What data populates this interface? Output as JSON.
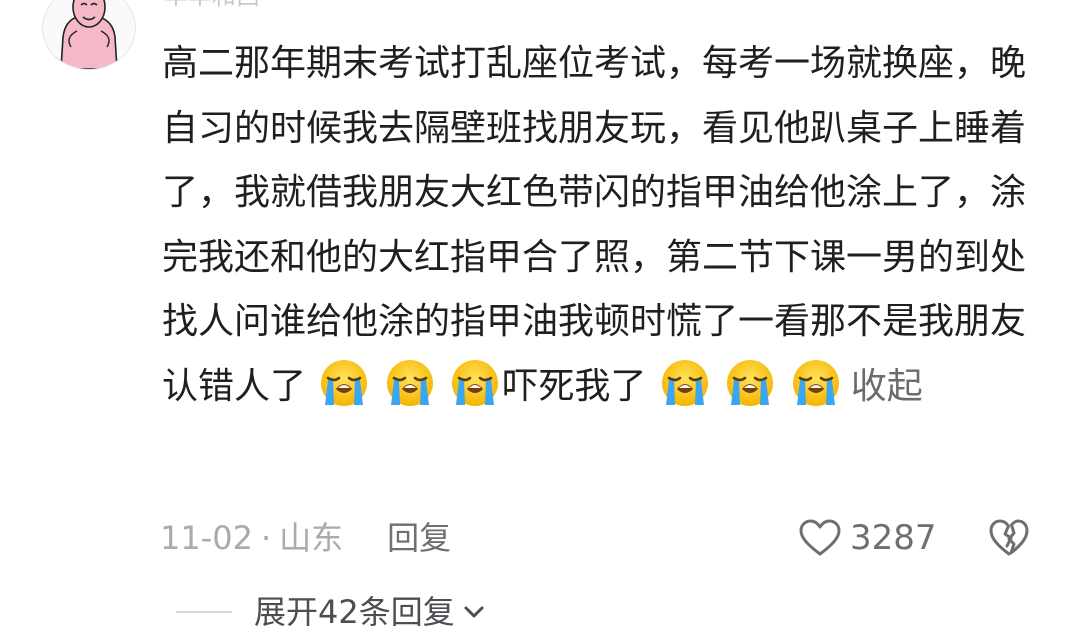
{
  "comment": {
    "username": "羊羊和西",
    "text_before_emoji_1": "高二那年期末考试打乱座位考试，每考一场就换座，晚自习的时候我去隔壁班找朋友玩，看见他趴桌子上睡着了，我就借我朋友大红色带闪的指甲油给他涂上了，涂完我还和他的大红指甲合了照，第二节下课一男的到处找人问谁给他涂的指甲油我顿时慌了一看那不是我朋友认错人了",
    "text_after_emoji_1": "吓死我了",
    "emoji_icon": "loudly-crying-face-emoji",
    "collapse_label": "收起",
    "date": "11-02",
    "separator": "·",
    "location": "山东",
    "reply_label": "回复",
    "like_count": "3287",
    "expand_replies_label": "展开42条回复"
  },
  "colors": {
    "text": "#1f1f1f",
    "meta": "#a9a9ae",
    "secondary": "#6e6e73",
    "avatar_skin": "#f4b8c6"
  }
}
